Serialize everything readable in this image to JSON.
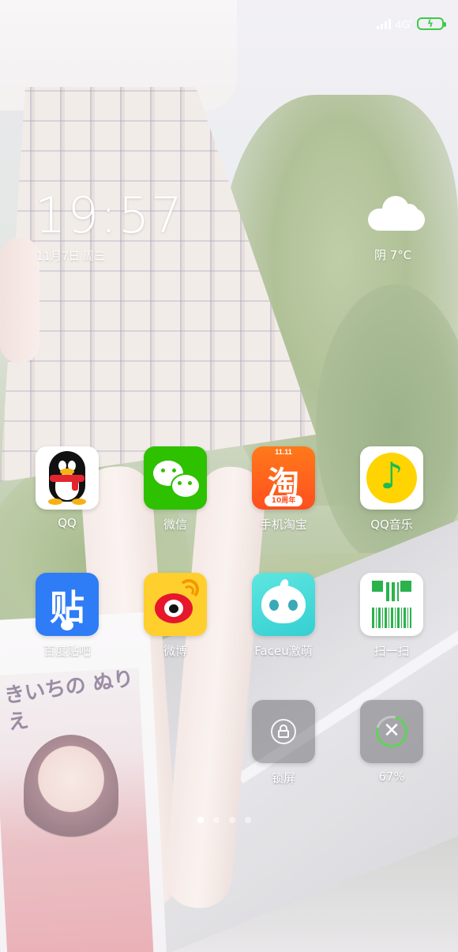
{
  "status_bar": {
    "network": "4G",
    "network_suffix": "t",
    "signal_icon": "signal-icon",
    "battery_icon": "battery-charging-icon",
    "battery_color": "#3ec94b"
  },
  "clock_widget": {
    "time": "19:57",
    "date": "11月7日  周三"
  },
  "weather_widget": {
    "icon": "cloud-icon",
    "text": "阴  7°C"
  },
  "apps": [
    {
      "label": "QQ",
      "icon": "qq-penguin-icon"
    },
    {
      "label": "微信",
      "icon": "wechat-icon"
    },
    {
      "label": "手机淘宝",
      "icon": "taobao-icon",
      "icon_text": "淘",
      "badge_top": "11.11",
      "badge_bottom": "10周年"
    },
    {
      "label": "QQ音乐",
      "icon": "qq-music-icon",
      "icon_text": "♪"
    },
    {
      "label": "百度贴吧",
      "icon": "tieba-icon",
      "icon_text": "贴"
    },
    {
      "label": "微博",
      "icon": "weibo-icon"
    },
    {
      "label": "Faceu激萌",
      "icon": "faceu-icon"
    },
    {
      "label": "扫一扫",
      "icon": "scan-icon"
    }
  ],
  "widgets": {
    "lock": {
      "label": "锁屏",
      "icon": "lock-icon"
    },
    "cleaner": {
      "label": "67%",
      "icon": "close-icon",
      "level_percent": 67,
      "icon_text": "✕"
    }
  },
  "page_indicator": {
    "count": 4,
    "active_index": 0
  },
  "wallpaper": {
    "book_title": "きいちの ぬりえ"
  }
}
